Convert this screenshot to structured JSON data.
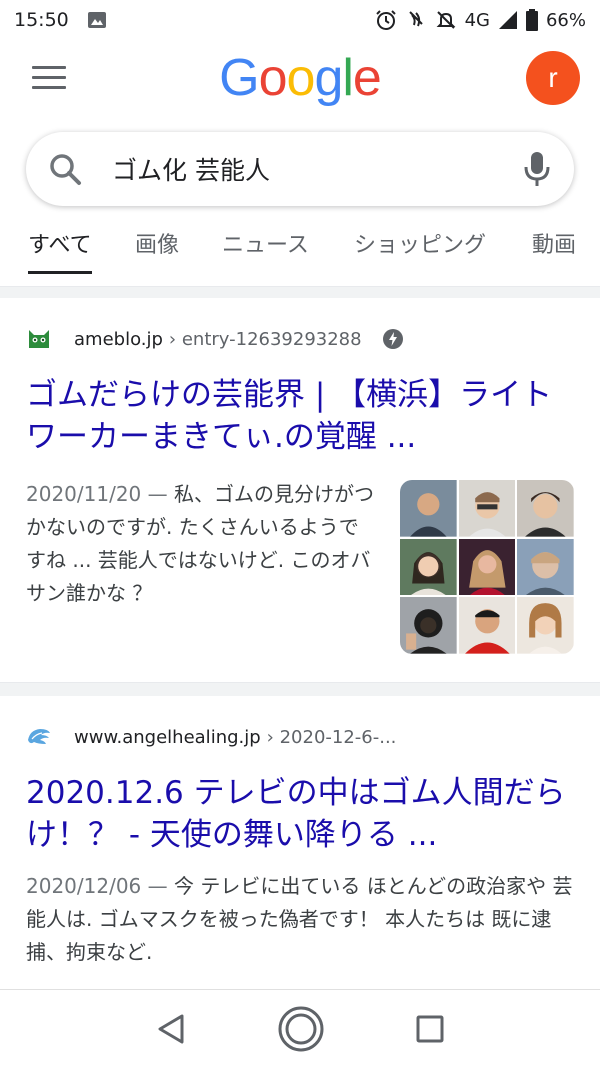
{
  "status_bar": {
    "time": "15:50",
    "network": "4G",
    "battery": "66%"
  },
  "header": {
    "logo_letters": [
      {
        "ch": "G",
        "color": "#4285F4"
      },
      {
        "ch": "o",
        "color": "#EA4335"
      },
      {
        "ch": "o",
        "color": "#FBBC05"
      },
      {
        "ch": "g",
        "color": "#4285F4"
      },
      {
        "ch": "l",
        "color": "#34A853"
      },
      {
        "ch": "e",
        "color": "#EA4335"
      }
    ],
    "avatar_letter": "r"
  },
  "search": {
    "query": "ゴム化 芸能人"
  },
  "tabs": [
    "すべて",
    "画像",
    "ニュース",
    "ショッピング",
    "動画"
  ],
  "results": [
    {
      "domain": "ameblo.jp",
      "path": "› entry-12639293288",
      "title": "ゴムだらけの芸能界 | 【横浜】ライトワーカーまきてぃ.の覚醒 ...",
      "date": "2020/11/20 —",
      "snippet": " 私、ゴムの見分けがつかないのですが. たくさんいるようですね ... 芸能人ではないけど. このオバサン誰かな ？"
    },
    {
      "domain": "www.angelhealing.jp",
      "path": "› 2020-12-6-...",
      "title": "2020.12.6 テレビの中はゴム人間だらけ！？ - 天使の舞い降りる ...",
      "date": "2020/12/06 —",
      "snippet": " 今 テレビに出ている ほとんどの政治家や 芸能人は. ゴムマスクを被った偽者です！ 本人たちは 既に逮捕、拘束など."
    }
  ],
  "colors": {
    "link": "#1a0dab",
    "accent": "#f4511e"
  }
}
